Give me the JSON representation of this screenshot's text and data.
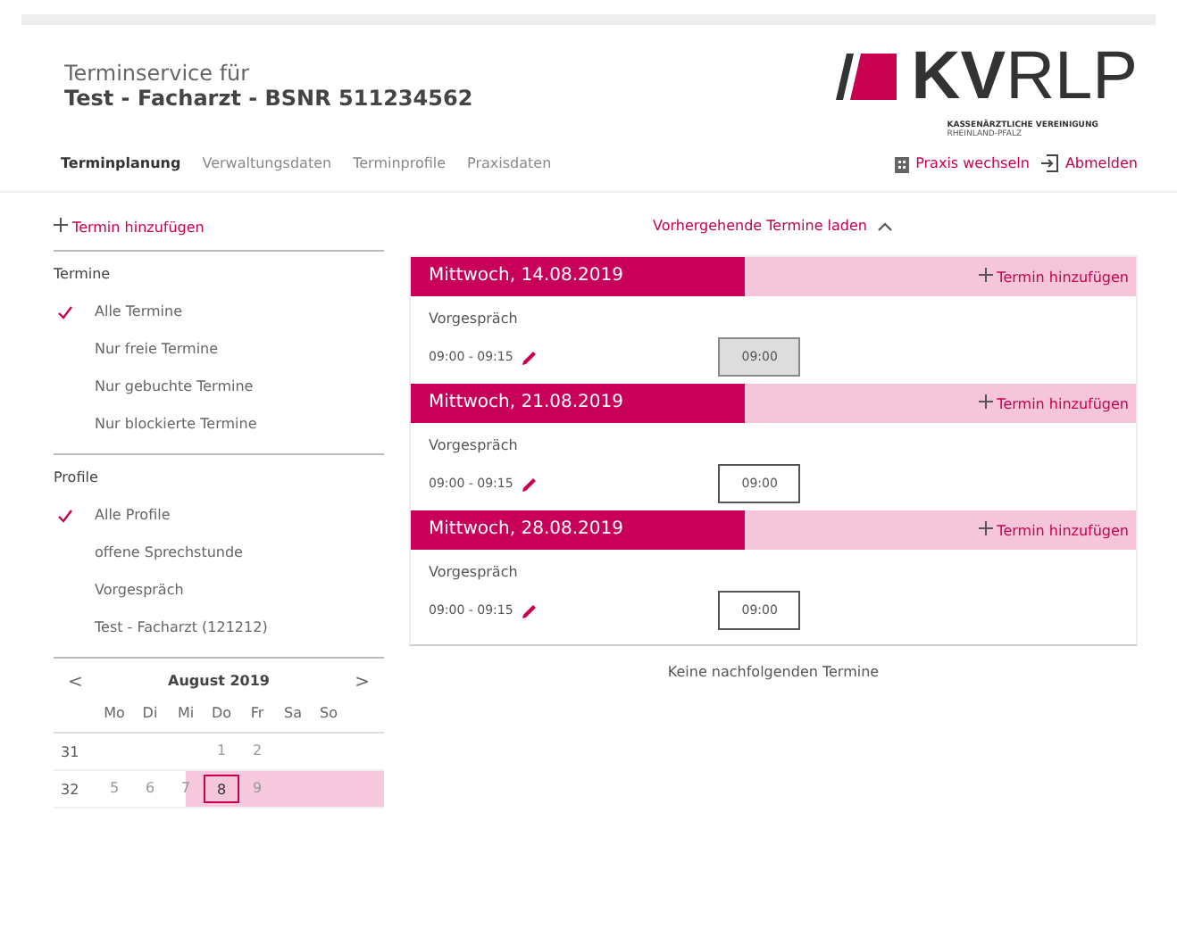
{
  "header": {
    "subtitle": "Terminservice für",
    "title": "Test - Facharzt - BSNR 511234562",
    "logo": {
      "mark": "KV",
      "rest": "RLP",
      "tagline": "KASSENÄRZTLICHE VEREINIGUNG",
      "region": "RHEINLAND-PFALZ"
    }
  },
  "nav": [
    {
      "label": "Terminplanung",
      "selected": true
    },
    {
      "label": "Verwaltungsdaten",
      "selected": false
    },
    {
      "label": "Terminprofile",
      "selected": false
    },
    {
      "label": "Praxisdaten",
      "selected": false
    }
  ],
  "actions": [
    {
      "kind": "switch",
      "label": "Praxis wechseln"
    },
    {
      "kind": "logout",
      "label": "Abmelden"
    }
  ],
  "sidebar": {
    "add": "Termin hinzufügen",
    "groups": [
      {
        "title": "Termine",
        "items": [
          {
            "label": "Alle Termine",
            "checked": true
          },
          {
            "label": "Nur freie Termine",
            "checked": false
          },
          {
            "label": "Nur gebuchte Termine",
            "checked": false
          },
          {
            "label": "Nur blockierte Termine",
            "checked": false
          }
        ]
      },
      {
        "title": "Profile",
        "items": [
          {
            "label": "Alle Profile",
            "checked": true
          },
          {
            "label": "offene Sprechstunde",
            "checked": false
          },
          {
            "label": "Vorgespräch",
            "checked": false
          },
          {
            "label": "Test - Facharzt (121212)",
            "checked": false
          }
        ]
      }
    ],
    "calendar": {
      "prev": "<",
      "month": "August 2019",
      "next": ">",
      "weekdays": [
        "Mo",
        "Di",
        "Mi",
        "Do",
        "Fr",
        "Sa",
        "So"
      ],
      "weeks": [
        {
          "number": "31",
          "highlighted": false,
          "days": [
            {
              "kind": "blank"
            },
            {
              "kind": "blank"
            },
            {
              "kind": "blank"
            },
            {
              "kind": "day",
              "day": "1",
              "selected": false
            },
            {
              "kind": "day",
              "day": "2",
              "selected": false
            },
            {
              "kind": "blank"
            },
            {
              "kind": "blank"
            }
          ]
        },
        {
          "number": "32",
          "highlighted": true,
          "days": [
            {
              "kind": "day",
              "day": "5",
              "selected": false
            },
            {
              "kind": "day",
              "day": "6",
              "selected": false
            },
            {
              "kind": "day",
              "day": "7",
              "selected": false
            },
            {
              "kind": "day",
              "day": "8",
              "selected": true
            },
            {
              "kind": "day",
              "day": "9",
              "selected": false
            },
            {
              "kind": "blank"
            },
            {
              "kind": "blank"
            }
          ]
        }
      ]
    }
  },
  "main": {
    "previous": "Vorhergehende Termine laden",
    "footer": "Keine nachfolgenden Termine",
    "days": [
      {
        "date": "Mittwoch, 14.08.2019",
        "add": "Termin hinzufügen",
        "profile": "Vorgespräch",
        "time": "09:00 - 09:15",
        "slots": [
          {
            "label": "09:00",
            "selected": true
          }
        ]
      },
      {
        "date": "Mittwoch, 21.08.2019",
        "add": "Termin hinzufügen",
        "profile": "Vorgespräch",
        "time": "09:00 - 09:15",
        "slots": [
          {
            "label": "09:00",
            "selected": false
          }
        ]
      },
      {
        "date": "Mittwoch, 28.08.2019",
        "add": "Termin hinzufügen",
        "profile": "Vorgespräch",
        "time": "09:00 - 09:15",
        "slots": [
          {
            "label": "09:00",
            "selected": false
          }
        ]
      }
    ]
  }
}
